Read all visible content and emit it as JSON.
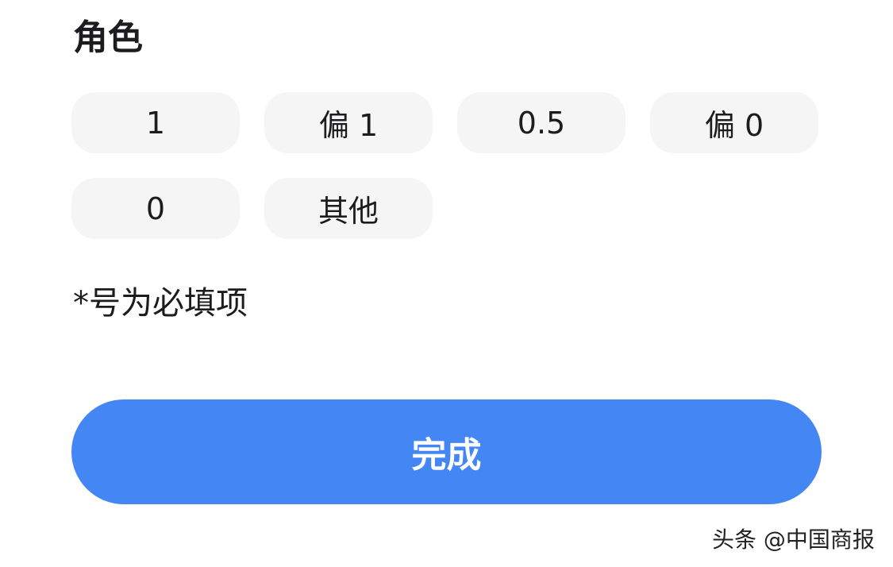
{
  "section": {
    "title": "角色",
    "options": [
      {
        "label": "1"
      },
      {
        "label": "偏 1"
      },
      {
        "label": "0.5"
      },
      {
        "label": "偏 0"
      },
      {
        "label": "0"
      },
      {
        "label": "其他"
      }
    ]
  },
  "note": "*号为必填项",
  "done_button": {
    "label": "完成",
    "color": "#4487f4"
  },
  "watermark": "头条 @中国商报"
}
